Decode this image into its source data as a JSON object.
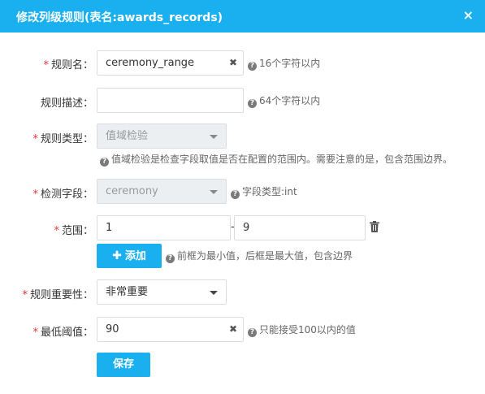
{
  "dialog": {
    "title": "修改列级规则(表名:awards_records)",
    "close_icon": "×"
  },
  "form": {
    "rule_name": {
      "label": "规则名：",
      "value": "ceremony_range",
      "hint": "16个字符以内"
    },
    "rule_desc": {
      "label": "规则描述：",
      "value": "",
      "hint": "64个字符以内"
    },
    "rule_type": {
      "label": "规则类型：",
      "value": "值域检验",
      "hint": "值域检验是检查字段取值是否在配置的范围内。需要注意的是，包含范围边界。"
    },
    "check_field": {
      "label": "检测字段：",
      "value": "ceremony",
      "hint": "字段类型:int"
    },
    "range": {
      "label": "范围：",
      "min": "1",
      "separator": "-",
      "max": "9",
      "add_button": "添加",
      "hint": "前框为最小值，后框是最大值，包含边界"
    },
    "importance": {
      "label": "规则重要性：",
      "value": "非常重要"
    },
    "threshold": {
      "label": "最低阈值：",
      "value": "90",
      "hint": "只能接受100以内的值"
    },
    "save_button": "保存",
    "required_mark": "*",
    "help_icon": "?",
    "clear_icon": "✖"
  }
}
